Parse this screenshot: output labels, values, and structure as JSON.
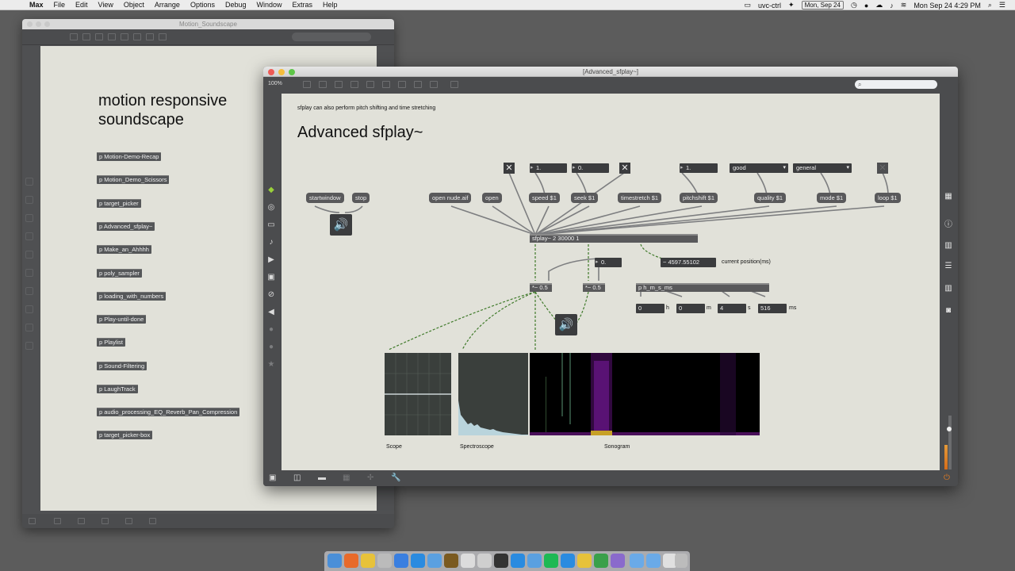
{
  "menubar": {
    "app_name": "Max",
    "items": [
      "File",
      "Edit",
      "View",
      "Object",
      "Arrange",
      "Options",
      "Debug",
      "Window",
      "Extras",
      "Help"
    ],
    "status_user": "uvc-ctrl",
    "status_date_badge": "Mon, Sep 24",
    "clock": "Mon Sep 24  4:29 PM"
  },
  "back_window": {
    "title": "Motion_Soundscape",
    "heading": "motion responsive\nsoundscape",
    "subpatchers": [
      "p Motion-Demo-Recap",
      "p Motion_Demo_Scissors",
      "p target_picker",
      "p Advanced_sfplay~",
      "p Make_an_Ahhhh",
      "p poly_sampler",
      "p loading_with_numbers",
      "p Play-until-done",
      "p Playlist",
      "p Sound-Filtering",
      "p LaughTrack",
      "p audio_processing_EQ_Reverb_Pan_Compression",
      "p target_picker-box"
    ]
  },
  "front_window": {
    "title": "[Advanced_sfplay~]",
    "zoom": "100%",
    "patch": {
      "subtitle": "sfplay can also perform pitch shifting and time stretching",
      "title": "Advanced sfplay~",
      "messages": {
        "startwindow": "startwindow",
        "stop": "stop",
        "open_file": "open nude.aif",
        "open": "open",
        "speed": "speed $1",
        "seek": "seek $1",
        "timestretch": "timestretch $1",
        "pitchshift": "pitchshift $1",
        "quality": "quality $1",
        "mode": "mode $1",
        "loop": "loop $1"
      },
      "numbers": {
        "speed": "1.",
        "seek": "0.",
        "pitchshift": "1.",
        "position_float": "0.",
        "current_position": "~ 4597.55102",
        "hours": "0",
        "minutes": "0",
        "seconds": "4",
        "milliseconds": "516"
      },
      "menus": {
        "quality": "good",
        "mode": "general"
      },
      "objects": {
        "sfplay": "sfplay~ 2 30000 1",
        "gain_left": "*~ 0.5",
        "gain_right": "*~ 0.5",
        "hms": "p h_m_s_ms"
      },
      "labels": {
        "current_position": "current position(ms)",
        "h": "h",
        "m": "m",
        "s": "s",
        "ms": "ms",
        "scope": "Scope",
        "spectroscope": "Spectroscope",
        "sonogram": "Sonogram"
      }
    },
    "meter_level": 0.45
  },
  "colors": {
    "canvas": "#e1e1d9",
    "object": "#59595b",
    "patchcord_signal": "#3f7a2a",
    "accent_orange": "#e07b24"
  }
}
